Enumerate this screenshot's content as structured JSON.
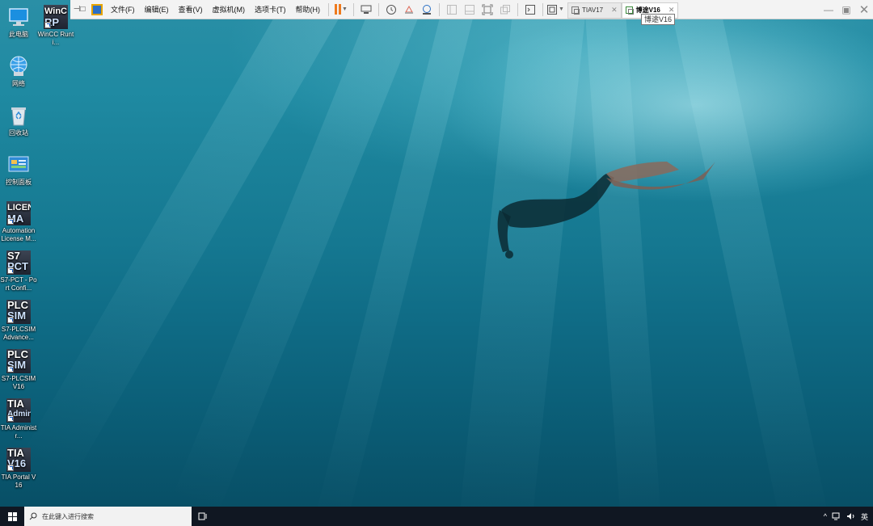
{
  "desktop": {
    "icons": [
      {
        "label": "此电脑",
        "icon": "computer-icon"
      },
      {
        "label": "网络",
        "icon": "network-icon"
      },
      {
        "label": "回收站",
        "icon": "recycle-bin-icon"
      },
      {
        "label": "控制面板",
        "icon": "control-panel-icon"
      },
      {
        "label": "Automation License M...",
        "icon": "automation-license-manager-icon",
        "tile1": "LICEN",
        "tile2": "MA"
      },
      {
        "label": "S7-PCT - Port Confi...",
        "icon": "s7-pct-icon",
        "tile1": "S7",
        "tile2": "PCT"
      },
      {
        "label": "S7-PLCSIM Advance...",
        "icon": "s7-plcsim-advanced-icon",
        "tile1": "PLC",
        "tile2": "SIM"
      },
      {
        "label": "S7-PLCSIM V16",
        "icon": "s7-plcsim-v16-icon",
        "tile1": "PLC",
        "tile2": "SIM"
      },
      {
        "label": "TIA Administr...",
        "icon": "tia-administrator-icon",
        "tile1": "TIA",
        "tile2": "Admin"
      },
      {
        "label": "TIA Portal V16",
        "icon": "tia-portal-v16-icon",
        "tile1": "TIA",
        "tile2": "V16"
      },
      {
        "label": "WinCC Runti...",
        "icon": "wincc-runtime-icon",
        "tile1": "WinC",
        "tile2": "RP"
      }
    ]
  },
  "toolbar": {
    "menu": [
      "文件(F)",
      "编辑(E)",
      "查看(V)",
      "虚拟机(M)",
      "选项卡(T)",
      "帮助(H)"
    ],
    "tabs": [
      {
        "label": "TIAV17",
        "active": false
      },
      {
        "label": "博途V16",
        "active": true
      }
    ],
    "tooltip": "博途V16"
  },
  "taskbar": {
    "search_placeholder": "在此键入进行搜索",
    "input_method": "英"
  }
}
